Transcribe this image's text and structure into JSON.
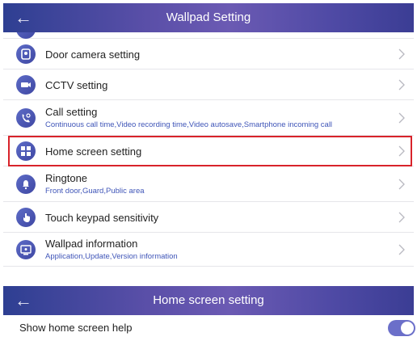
{
  "screen1": {
    "title": "Wallpad Setting",
    "back_icon": "arrow-left-icon",
    "items": [
      {
        "label": "Door camera setting",
        "sub": "",
        "icon": "door-camera-icon"
      },
      {
        "label": "CCTV setting",
        "sub": "",
        "icon": "cctv-icon"
      },
      {
        "label": "Call setting",
        "sub": "Continuous call time,Video recording time,Video autosave,Smartphone incoming call",
        "icon": "call-settings-icon"
      },
      {
        "label": "Home screen setting",
        "sub": "",
        "icon": "home-screen-icon"
      },
      {
        "label": "Ringtone",
        "sub": "Front door,Guard,Public area",
        "icon": "ringtone-icon"
      },
      {
        "label": "Touch keypad sensitivity",
        "sub": "",
        "icon": "touch-icon"
      },
      {
        "label": "Wallpad information",
        "sub": "Application,Update,Version information",
        "icon": "info-icon"
      }
    ],
    "highlighted_item": "Home screen setting",
    "highlight_color": "#d8232a"
  },
  "screen2": {
    "title": "Home screen setting",
    "back_icon": "arrow-left-icon",
    "toggle_label": "Show home screen help",
    "toggle_on": true
  },
  "colors": {
    "header_start": "#2e3f92",
    "header_mid": "#6b5ab3",
    "subtitle": "#3f55b8",
    "icon_bg": "#4f5ab8",
    "toggle": "#6b6fc9"
  }
}
